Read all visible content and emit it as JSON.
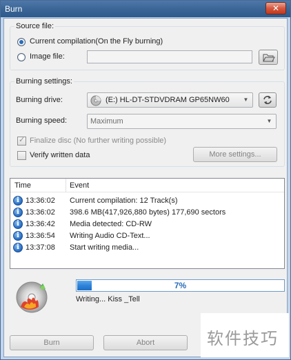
{
  "window": {
    "title": "Burn",
    "close_label": "✕"
  },
  "source": {
    "group_title": "Source file:",
    "current_compilation_label": "Current compilation(On the Fly burning)",
    "current_compilation_selected": true,
    "image_file_label": "Image file:",
    "image_file_value": ""
  },
  "burning": {
    "group_title": "Burning settings:",
    "drive_label": "Burning drive:",
    "drive_value": "(E:) HL-DT-STDVDRAM GP65NW60",
    "speed_label": "Burning speed:",
    "speed_value": "Maximum",
    "finalize_label": "Finalize disc (No further writing possible)",
    "finalize_checked": true,
    "verify_label": "Verify written data",
    "verify_checked": false,
    "more_settings_label": "More settings..."
  },
  "log": {
    "columns": {
      "time": "Time",
      "event": "Event"
    },
    "rows": [
      {
        "time": "13:36:02",
        "event": "Current compilation: 12 Track(s)"
      },
      {
        "time": "13:36:02",
        "event": "398.6 MB(417,926,880 bytes)  177,690 sectors"
      },
      {
        "time": "13:36:42",
        "event": "Media detected: CD-RW"
      },
      {
        "time": "13:36:54",
        "event": "Writing Audio CD-Text..."
      },
      {
        "time": "13:37:08",
        "event": "Start writing media..."
      }
    ]
  },
  "progress": {
    "percent_label": "7%",
    "value": 0.07,
    "status": "Writing... Kiss _Tell"
  },
  "buttons": {
    "burn": "Burn",
    "abort": "Abort"
  },
  "watermark": "软件技巧",
  "colors": {
    "accent": "#2e84d8",
    "title_bar": "#3b6696",
    "close_button": "#d6583f"
  }
}
